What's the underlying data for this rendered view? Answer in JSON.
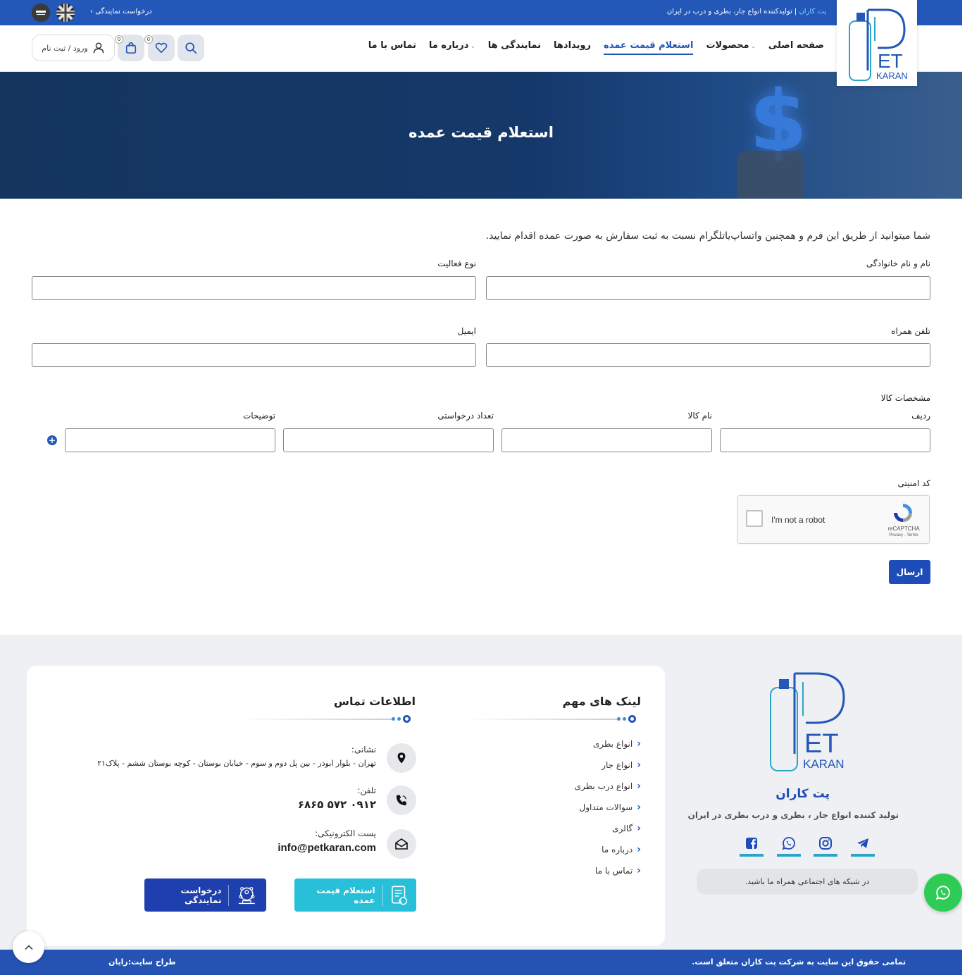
{
  "topbar": {
    "brand": "پت کاران",
    "tagline": " | تولیدکننده انواع جار، بطری و درب در ایران",
    "agency_link": "درخواست نمایندگی"
  },
  "header": {
    "logo_alt": "PETKARAN",
    "nav": [
      {
        "label": "صفحه اصلی",
        "has_caret": false,
        "active": false
      },
      {
        "label": "محصولات",
        "has_caret": true,
        "active": false
      },
      {
        "label": "استعلام قیمت عمده",
        "has_caret": false,
        "active": true
      },
      {
        "label": "رویدادها",
        "has_caret": false,
        "active": false
      },
      {
        "label": "نمایندگی ها",
        "has_caret": false,
        "active": false
      },
      {
        "label": "درباره ما",
        "has_caret": true,
        "active": false
      },
      {
        "label": "تماس با ما",
        "has_caret": false,
        "active": false
      }
    ],
    "cart_count": "0",
    "wishlist_count": "0",
    "login_label": "ورود / ثبت نام"
  },
  "hero": {
    "title": "استعلام قیمت عمده"
  },
  "form": {
    "intro": "شما میتوانید از طریق این فرم و همچنین واتساپ‌یاتلگرام نسبت به ثبت سفارش به صورت عمده اقدام نمایید.",
    "fields": {
      "full_name": {
        "label": "نام و نام خانوادگی",
        "value": ""
      },
      "activity_type": {
        "label": "نوع فعالیت",
        "value": ""
      },
      "mobile": {
        "label": "تلفن همراه",
        "value": ""
      },
      "email": {
        "label": "ایمیل",
        "value": ""
      }
    },
    "product_spec_title": "مشخصات کالا",
    "product_columns": [
      "ردیف",
      "نام کالا",
      "تعداد درخواستی",
      "توضیحات"
    ],
    "captcha_label": "کد امنیتی",
    "captcha": {
      "text": "I'm not a robot",
      "brand": "reCAPTCHA",
      "terms": "Privacy - Terms"
    },
    "submit_label": "ارسال"
  },
  "footer": {
    "brand_name": "پت کاران",
    "brand_desc": "تولید کننده انواع جار ، بطری و درب بطری در ایران",
    "social_note": "در شبکه های اجتماعی همراه ما باشید.",
    "social_icons": [
      "telegram-icon",
      "instagram-icon",
      "whatsapp-icon",
      "facebook-icon"
    ],
    "links_title": "لینک های مهم",
    "links": [
      "انواع بطری",
      "انواع جار",
      "انواع درب بطری",
      "سوالات متداول",
      "گالری",
      "درباره ما",
      "تماس با ما"
    ],
    "contact_title": "اطلاعات تماس",
    "address_label": "نشانی:",
    "address": "تهران - بلوار ابوذر - بین پل دوم و سوم - خیابان بوستان - کوچه بوستان ششم - پلاک۲۱",
    "phone_label": "تلفن:",
    "phone": "۰۹۱۲ ۵۷۲ ۶۸۶۵",
    "email_label": "پست الکترونیکی:",
    "email": "info@petkaran.com",
    "cta_wholesale": "استعلام قیمت عمده",
    "cta_agency": "درخواست نمایندگی",
    "copyright": "تمامی حقوق این سایت به شرکت پت کاران متعلق است.",
    "designer": "طراح سایت:رایان"
  },
  "colors": {
    "primary": "#2357b8",
    "hero_bg": "#13355e",
    "cta_teal": "#28c0d8",
    "cta_blue": "#1e3fae",
    "whatsapp": "#2ecc55"
  }
}
